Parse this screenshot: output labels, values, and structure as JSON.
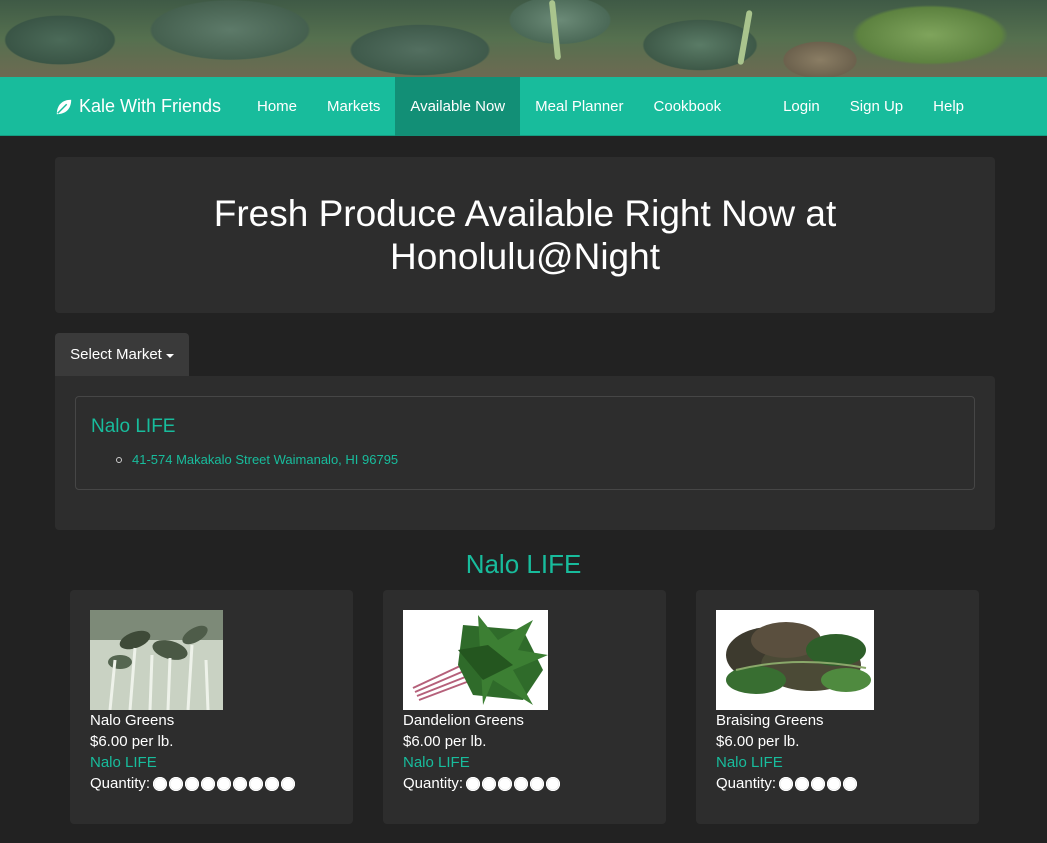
{
  "navbar": {
    "brand": "Kale With Friends",
    "left_items": [
      "Home",
      "Markets",
      "Available Now",
      "Meal Planner",
      "Cookbook"
    ],
    "right_items": [
      "Login",
      "Sign Up",
      "Help"
    ],
    "active": "Available Now"
  },
  "header": {
    "title": "Fresh Produce Available Right Now at Honolulu@Night"
  },
  "market_select": {
    "label": "Select Market"
  },
  "market": {
    "name": "Nalo LIFE",
    "address": "41-574 Makakalo Street Waimanalo, HI 96795"
  },
  "section": {
    "title": "Nalo LIFE"
  },
  "products": [
    {
      "name": "Nalo Greens",
      "price": "$6.00 per lb.",
      "vendor": "Nalo LIFE",
      "quantity_label": "Quantity:",
      "quantity": 9
    },
    {
      "name": "Dandelion Greens",
      "price": "$6.00 per lb.",
      "vendor": "Nalo LIFE",
      "quantity_label": "Quantity:",
      "quantity": 6
    },
    {
      "name": "Braising Greens",
      "price": "$6.00 per lb.",
      "vendor": "Nalo LIFE",
      "quantity_label": "Quantity:",
      "quantity": 5
    }
  ],
  "colors": {
    "accent": "#18bc9c",
    "background": "#222222",
    "panel": "#2d2d2d"
  },
  "icons": {
    "brand": "leaf-icon",
    "quantity": "flower-icon"
  }
}
